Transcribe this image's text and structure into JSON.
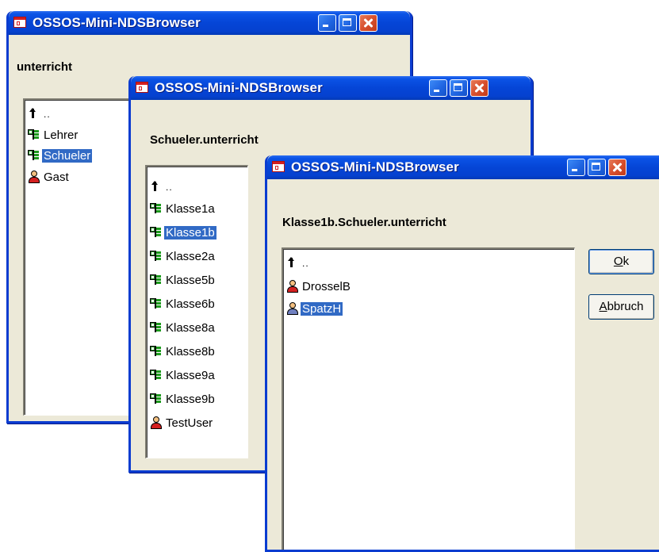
{
  "windows": [
    {
      "title": "OSSOS-Mini-NDSBrowser",
      "path": "unterricht",
      "items": [
        {
          "icon": "up-icon",
          "label": ".."
        },
        {
          "icon": "org-unit-icon",
          "label": "Lehrer"
        },
        {
          "icon": "org-unit-icon",
          "label": "Schueler",
          "selected": true
        },
        {
          "icon": "user-icon",
          "label": "Gast"
        }
      ]
    },
    {
      "title": "OSSOS-Mini-NDSBrowser",
      "path": "Schueler.unterricht",
      "items": [
        {
          "icon": "up-icon",
          "label": ".."
        },
        {
          "icon": "org-unit-icon",
          "label": "Klasse1a"
        },
        {
          "icon": "org-unit-icon",
          "label": "Klasse1b",
          "selected": true
        },
        {
          "icon": "org-unit-icon",
          "label": "Klasse2a"
        },
        {
          "icon": "org-unit-icon",
          "label": "Klasse5b"
        },
        {
          "icon": "org-unit-icon",
          "label": "Klasse6b"
        },
        {
          "icon": "org-unit-icon",
          "label": "Klasse8a"
        },
        {
          "icon": "org-unit-icon",
          "label": "Klasse8b"
        },
        {
          "icon": "org-unit-icon",
          "label": "Klasse9a"
        },
        {
          "icon": "org-unit-icon",
          "label": "Klasse9b"
        },
        {
          "icon": "user-icon",
          "label": "TestUser"
        }
      ]
    },
    {
      "title": "OSSOS-Mini-NDSBrowser",
      "path": "Klasse1b.Schueler.unterricht",
      "items": [
        {
          "icon": "up-icon",
          "label": ".."
        },
        {
          "icon": "user-icon",
          "label": "DrosselB"
        },
        {
          "icon": "user-icon",
          "label": "SpatzH",
          "selected": true
        }
      ],
      "buttons": {
        "ok": {
          "accel": "O",
          "rest": "k"
        },
        "cancel": {
          "accel": "A",
          "rest": "bbruch"
        }
      }
    }
  ],
  "colors": {
    "titlebar": "#0545d6",
    "window_face": "#ece9d8",
    "selection": "#316ac5",
    "close_button": "#d8502e"
  }
}
